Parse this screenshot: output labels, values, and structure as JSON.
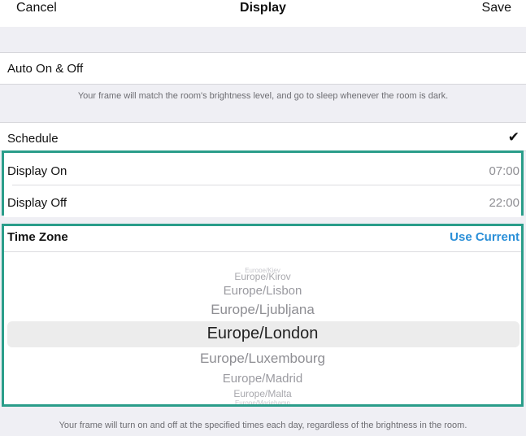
{
  "navbar": {
    "cancel": "Cancel",
    "title": "Display",
    "save": "Save"
  },
  "auto": {
    "label": "Auto On & Off",
    "footnote": "Your frame will match the room's brightness level, and go to sleep whenever the room is dark."
  },
  "schedule": {
    "label": "Schedule",
    "checked": true,
    "display_on_label": "Display On",
    "display_on_value": "07:00",
    "display_off_label": "Display Off",
    "display_off_value": "22:00"
  },
  "timezone": {
    "title": "Time Zone",
    "use_current": "Use Current",
    "options": [
      "Europe/Kiev",
      "Europe/Kirov",
      "Europe/Lisbon",
      "Europe/Ljubljana",
      "Europe/London",
      "Europe/Luxembourg",
      "Europe/Madrid",
      "Europe/Malta",
      "Europe/Mariehamn"
    ],
    "selected": "Europe/London"
  },
  "footer": {
    "note": "Your frame will turn on and off at the specified times each day, regardless of the brightness in the room."
  },
  "colors": {
    "accent": "#2a8fd8",
    "highlight_border": "#2a9d8a",
    "background": "#efeff4"
  }
}
